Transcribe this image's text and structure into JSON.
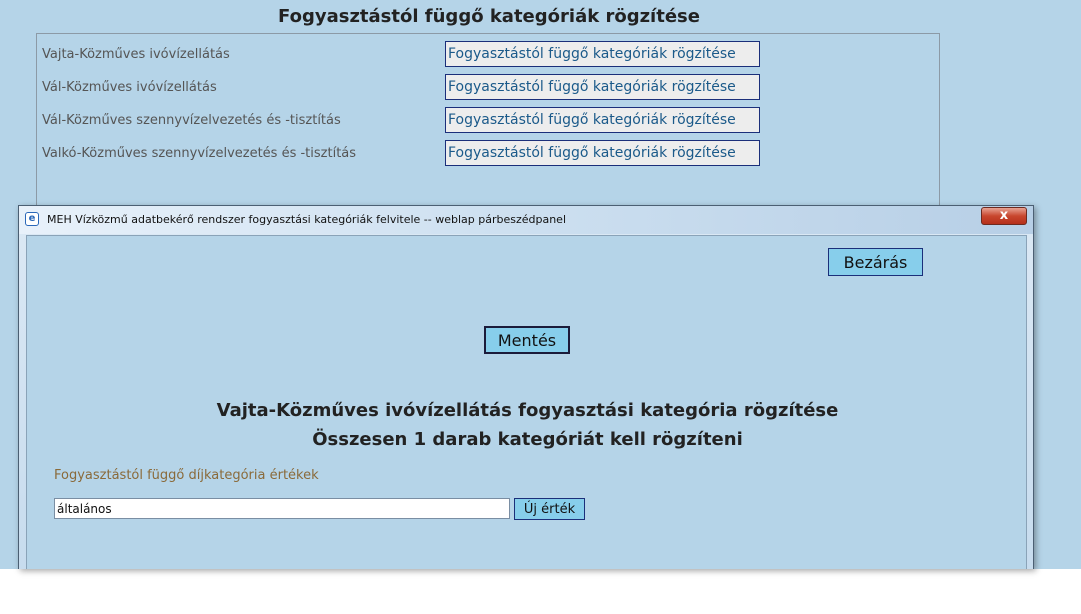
{
  "page": {
    "title": "Fogyasztástól függő kategóriák rögzítése",
    "rows": [
      {
        "label": "Vajta-Közműves ivóvízellátás",
        "button": "Fogyasztástól függő kategóriák rögzítése"
      },
      {
        "label": "Vál-Közműves ivóvízellátás",
        "button": "Fogyasztástól függő kategóriák rögzítése"
      },
      {
        "label": "Vál-Közműves szennyvízelvezetés és -tisztítás",
        "button": "Fogyasztástól függő kategóriák rögzítése"
      },
      {
        "label": "Valkó-Közműves szennyvízelvezetés és -tisztítás",
        "button": "Fogyasztástól függő kategóriák rögzítése"
      }
    ]
  },
  "dialog": {
    "title": "MEH Vízközmű adatbekérő rendszer fogyasztási kategóriák felvitele -- weblap párbeszédpanel",
    "close_glyph": "x",
    "close_label": "Bezárás",
    "save_label": "Mentés",
    "heading": "Vajta-Közműves ivóvízellátás fogyasztási kategória rögzítése",
    "subheading": "Összesen 1 darab kategóriát kell rögzíteni",
    "values_label": "Fogyasztástól függő díjkategória értékek",
    "input_value": "általános",
    "new_value_label": "Új érték"
  },
  "icons": {
    "browser": "ie-page-icon",
    "close": "close-x-icon"
  },
  "colors": {
    "background": "#b5d4e8",
    "button": "#87ceeb",
    "close": "#c8462e"
  }
}
